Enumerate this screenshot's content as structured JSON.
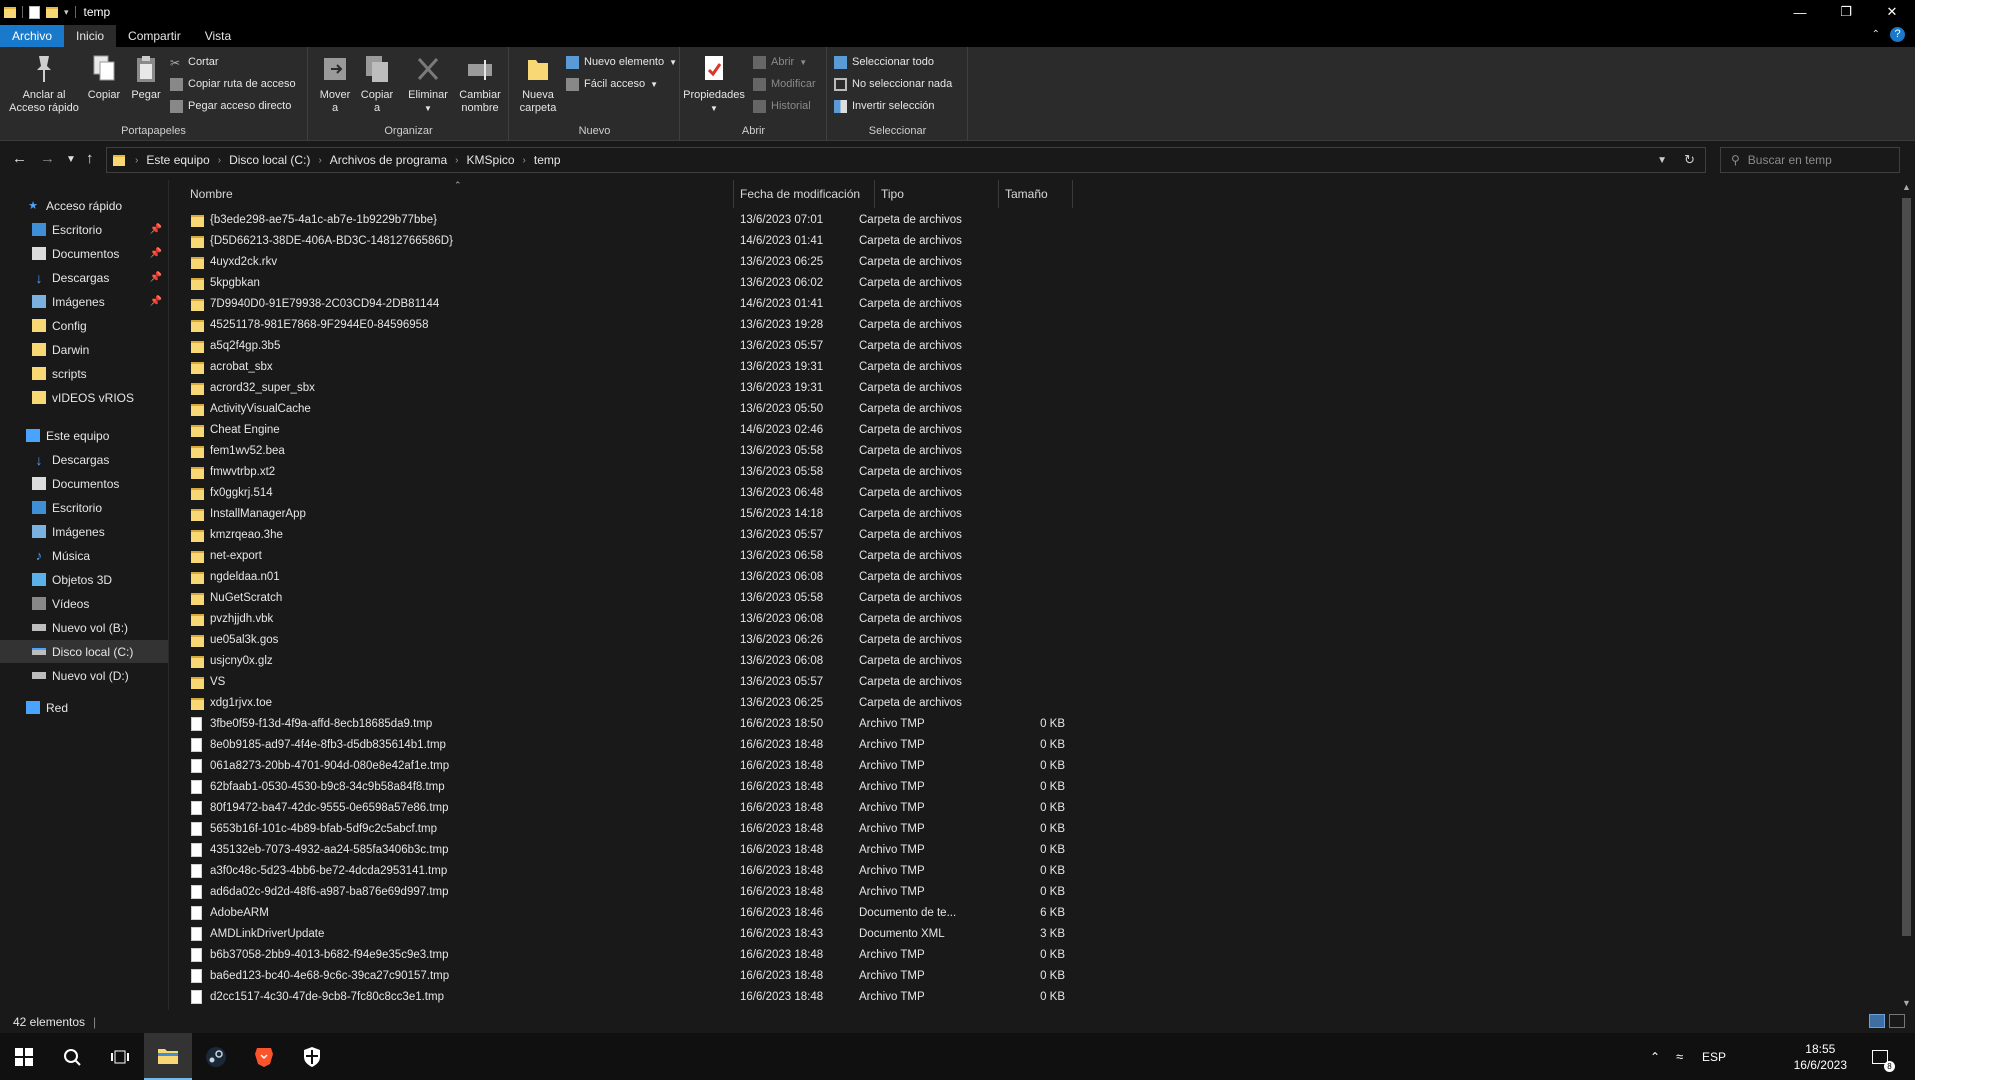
{
  "window": {
    "title": "temp"
  },
  "ribbon_tabs": [
    "Archivo",
    "Inicio",
    "Compartir",
    "Vista"
  ],
  "ribbon": {
    "portapapeles": {
      "label": "Portapapeles",
      "pin_label_1": "Anclar al",
      "pin_label_2": "Acceso rápido",
      "copy": "Copiar",
      "paste": "Pegar",
      "cut": "Cortar",
      "copy_path": "Copiar ruta de acceso",
      "paste_shortcut": "Pegar acceso directo"
    },
    "organizar": {
      "label": "Organizar",
      "move_1": "Mover",
      "move_2": "a",
      "copy_1": "Copiar",
      "copy_2": "a",
      "delete": "Eliminar",
      "rename_1": "Cambiar",
      "rename_2": "nombre"
    },
    "nuevo": {
      "label": "Nuevo",
      "new_folder_1": "Nueva",
      "new_folder_2": "carpeta",
      "new_item": "Nuevo elemento",
      "easy_access": "Fácil acceso"
    },
    "abrir": {
      "label": "Abrir",
      "properties": "Propiedades",
      "open": "Abrir",
      "edit": "Modificar",
      "history": "Historial"
    },
    "seleccionar": {
      "label": "Seleccionar",
      "select_all": "Seleccionar todo",
      "select_none": "No seleccionar nada",
      "invert": "Invertir selección"
    }
  },
  "breadcrumb": [
    "Este equipo",
    "Disco local (C:)",
    "Archivos de programa",
    "KMSpico",
    "temp"
  ],
  "search": {
    "placeholder": "Buscar en temp"
  },
  "nav": {
    "quick_access": "Acceso rápido",
    "quick_items": [
      "Escritorio",
      "Documentos",
      "Descargas",
      "Imágenes",
      "Config",
      "Darwin",
      "scripts",
      "vIDEOS vRIOS"
    ],
    "this_pc": "Este equipo",
    "pc_items": [
      "Descargas",
      "Documentos",
      "Escritorio",
      "Imágenes",
      "Música",
      "Objetos 3D",
      "Vídeos",
      "Nuevo vol (B:)",
      "Disco local (C:)",
      "Nuevo vol (D:)"
    ],
    "network": "Red"
  },
  "columns": {
    "name": "Nombre",
    "date": "Fecha de modificación",
    "type": "Tipo",
    "size": "Tamaño"
  },
  "files": [
    {
      "name": "{b3ede298-ae75-4a1c-ab7e-1b9229b77bbe}",
      "date": "13/6/2023 07:01",
      "type": "Carpeta de archivos",
      "size": "",
      "kind": "folder"
    },
    {
      "name": "{D5D66213-38DE-406A-BD3C-14812766586D}",
      "date": "14/6/2023 01:41",
      "type": "Carpeta de archivos",
      "size": "",
      "kind": "folder"
    },
    {
      "name": "4uyxd2ck.rkv",
      "date": "13/6/2023 06:25",
      "type": "Carpeta de archivos",
      "size": "",
      "kind": "folder"
    },
    {
      "name": "5kpgbkan",
      "date": "13/6/2023 06:02",
      "type": "Carpeta de archivos",
      "size": "",
      "kind": "folder"
    },
    {
      "name": "7D9940D0-91E79938-2C03CD94-2DB81144",
      "date": "14/6/2023 01:41",
      "type": "Carpeta de archivos",
      "size": "",
      "kind": "folder"
    },
    {
      "name": "45251178-981E7868-9F2944E0-84596958",
      "date": "13/6/2023 19:28",
      "type": "Carpeta de archivos",
      "size": "",
      "kind": "folder"
    },
    {
      "name": "a5q2f4gp.3b5",
      "date": "13/6/2023 05:57",
      "type": "Carpeta de archivos",
      "size": "",
      "kind": "folder"
    },
    {
      "name": "acrobat_sbx",
      "date": "13/6/2023 19:31",
      "type": "Carpeta de archivos",
      "size": "",
      "kind": "folder"
    },
    {
      "name": "acrord32_super_sbx",
      "date": "13/6/2023 19:31",
      "type": "Carpeta de archivos",
      "size": "",
      "kind": "folder"
    },
    {
      "name": "ActivityVisualCache",
      "date": "13/6/2023 05:50",
      "type": "Carpeta de archivos",
      "size": "",
      "kind": "folder"
    },
    {
      "name": "Cheat Engine",
      "date": "14/6/2023 02:46",
      "type": "Carpeta de archivos",
      "size": "",
      "kind": "folder"
    },
    {
      "name": "fem1wv52.bea",
      "date": "13/6/2023 05:58",
      "type": "Carpeta de archivos",
      "size": "",
      "kind": "folder"
    },
    {
      "name": "fmwvtrbp.xt2",
      "date": "13/6/2023 05:58",
      "type": "Carpeta de archivos",
      "size": "",
      "kind": "folder"
    },
    {
      "name": "fx0ggkrj.514",
      "date": "13/6/2023 06:48",
      "type": "Carpeta de archivos",
      "size": "",
      "kind": "folder"
    },
    {
      "name": "InstallManagerApp",
      "date": "15/6/2023 14:18",
      "type": "Carpeta de archivos",
      "size": "",
      "kind": "folder"
    },
    {
      "name": "kmzrqeao.3he",
      "date": "13/6/2023 05:57",
      "type": "Carpeta de archivos",
      "size": "",
      "kind": "folder"
    },
    {
      "name": "net-export",
      "date": "13/6/2023 06:58",
      "type": "Carpeta de archivos",
      "size": "",
      "kind": "folder"
    },
    {
      "name": "ngdeldaa.n01",
      "date": "13/6/2023 06:08",
      "type": "Carpeta de archivos",
      "size": "",
      "kind": "folder"
    },
    {
      "name": "NuGetScratch",
      "date": "13/6/2023 05:58",
      "type": "Carpeta de archivos",
      "size": "",
      "kind": "folder"
    },
    {
      "name": "pvzhjjdh.vbk",
      "date": "13/6/2023 06:08",
      "type": "Carpeta de archivos",
      "size": "",
      "kind": "folder"
    },
    {
      "name": "ue05al3k.gos",
      "date": "13/6/2023 06:26",
      "type": "Carpeta de archivos",
      "size": "",
      "kind": "folder"
    },
    {
      "name": "usjcny0x.glz",
      "date": "13/6/2023 06:08",
      "type": "Carpeta de archivos",
      "size": "",
      "kind": "folder"
    },
    {
      "name": "VS",
      "date": "13/6/2023 05:57",
      "type": "Carpeta de archivos",
      "size": "",
      "kind": "folder"
    },
    {
      "name": "xdg1rjvx.toe",
      "date": "13/6/2023 06:25",
      "type": "Carpeta de archivos",
      "size": "",
      "kind": "folder"
    },
    {
      "name": "3fbe0f59-f13d-4f9a-affd-8ecb18685da9.tmp",
      "date": "16/6/2023 18:50",
      "type": "Archivo TMP",
      "size": "0 KB",
      "kind": "file"
    },
    {
      "name": "8e0b9185-ad97-4f4e-8fb3-d5db835614b1.tmp",
      "date": "16/6/2023 18:48",
      "type": "Archivo TMP",
      "size": "0 KB",
      "kind": "file"
    },
    {
      "name": "061a8273-20bb-4701-904d-080e8e42af1e.tmp",
      "date": "16/6/2023 18:48",
      "type": "Archivo TMP",
      "size": "0 KB",
      "kind": "file"
    },
    {
      "name": "62bfaab1-0530-4530-b9c8-34c9b58a84f8.tmp",
      "date": "16/6/2023 18:48",
      "type": "Archivo TMP",
      "size": "0 KB",
      "kind": "file"
    },
    {
      "name": "80f19472-ba47-42dc-9555-0e6598a57e86.tmp",
      "date": "16/6/2023 18:48",
      "type": "Archivo TMP",
      "size": "0 KB",
      "kind": "file"
    },
    {
      "name": "5653b16f-101c-4b89-bfab-5df9c2c5abcf.tmp",
      "date": "16/6/2023 18:48",
      "type": "Archivo TMP",
      "size": "0 KB",
      "kind": "file"
    },
    {
      "name": "435132eb-7073-4932-aa24-585fa3406b3c.tmp",
      "date": "16/6/2023 18:48",
      "type": "Archivo TMP",
      "size": "0 KB",
      "kind": "file"
    },
    {
      "name": "a3f0c48c-5d23-4bb6-be72-4dcda2953141.tmp",
      "date": "16/6/2023 18:48",
      "type": "Archivo TMP",
      "size": "0 KB",
      "kind": "file"
    },
    {
      "name": "ad6da02c-9d2d-48f6-a987-ba876e69d997.tmp",
      "date": "16/6/2023 18:48",
      "type": "Archivo TMP",
      "size": "0 KB",
      "kind": "file"
    },
    {
      "name": "AdobeARM",
      "date": "16/6/2023 18:46",
      "type": "Documento de te...",
      "size": "6 KB",
      "kind": "file"
    },
    {
      "name": "AMDLinkDriverUpdate",
      "date": "16/6/2023 18:43",
      "type": "Documento XML",
      "size": "3 KB",
      "kind": "xml"
    },
    {
      "name": "b6b37058-2bb9-4013-b682-f94e9e35c9e3.tmp",
      "date": "16/6/2023 18:48",
      "type": "Archivo TMP",
      "size": "0 KB",
      "kind": "file"
    },
    {
      "name": "ba6ed123-bc40-4e68-9c6c-39ca27c90157.tmp",
      "date": "16/6/2023 18:48",
      "type": "Archivo TMP",
      "size": "0 KB",
      "kind": "file"
    },
    {
      "name": "d2cc1517-4c30-47de-9cb8-7fc80c8cc3e1.tmp",
      "date": "16/6/2023 18:48",
      "type": "Archivo TMP",
      "size": "0 KB",
      "kind": "file"
    }
  ],
  "status": {
    "count": "42 elementos"
  },
  "taskbar": {
    "lang": "ESP",
    "time": "18:55",
    "date": "16/6/2023",
    "notif_count": "8"
  },
  "colors": {
    "accent": "#1979ca",
    "folder": "#f8d775",
    "background": "#191919"
  }
}
